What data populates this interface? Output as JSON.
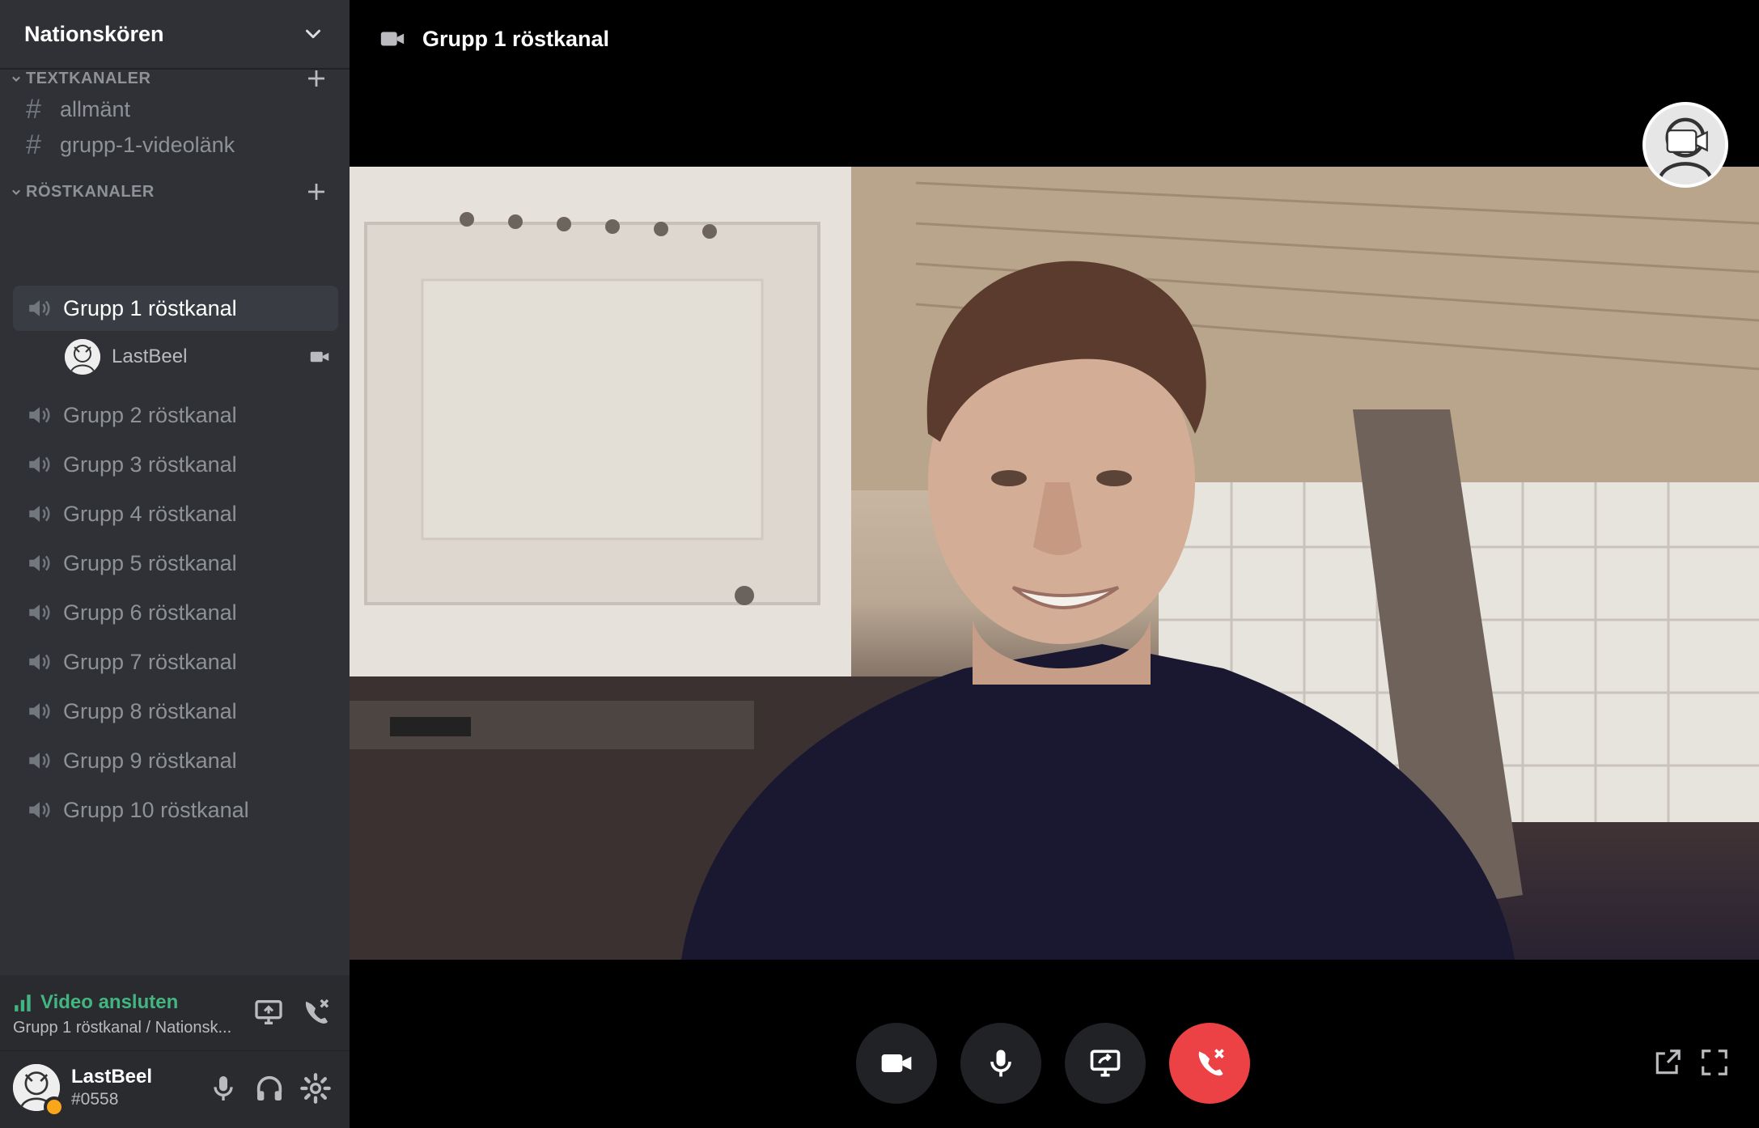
{
  "server": {
    "name": "Nationskören"
  },
  "categories": {
    "text": {
      "label": "TEXTKANALER"
    },
    "voice": {
      "label": "RÖSTKANALER"
    }
  },
  "text_channels": [
    {
      "name": "allmänt"
    },
    {
      "name": "grupp-1-videolänk"
    }
  ],
  "voice_channels": [
    {
      "name": "Grupp 1 röstkanal",
      "active": true
    },
    {
      "name": "Grupp 2 röstkanal"
    },
    {
      "name": "Grupp 3 röstkanal"
    },
    {
      "name": "Grupp 4 röstkanal"
    },
    {
      "name": "Grupp 5 röstkanal"
    },
    {
      "name": "Grupp 6 röstkanal"
    },
    {
      "name": "Grupp 7 röstkanal"
    },
    {
      "name": "Grupp 8 röstkanal"
    },
    {
      "name": "Grupp 9 röstkanal"
    },
    {
      "name": "Grupp 10 röstkanal"
    }
  ],
  "voice_members": [
    {
      "name": "LastBeel",
      "video": true
    }
  ],
  "connection": {
    "status": "Video ansluten",
    "subtitle": "Grupp 1 röstkanal / Nationsk...",
    "status_color": "#43b581"
  },
  "user": {
    "name": "LastBeel",
    "tag": "#0558",
    "status_color": "#faa61a"
  },
  "main": {
    "title": "Grupp 1 röstkanal"
  },
  "controls": [
    {
      "icon": "camera-icon"
    },
    {
      "icon": "microphone-icon"
    },
    {
      "icon": "screen-share-icon"
    },
    {
      "icon": "disconnect-icon",
      "color": "#ed4245"
    }
  ],
  "icons": {
    "header": "chevron-down-icon",
    "category_add": "plus-icon",
    "text_channel": "hash-icon",
    "voice_channel": "speaker-icon",
    "popout": "popout-icon",
    "fullscreen": "fullscreen-icon"
  }
}
